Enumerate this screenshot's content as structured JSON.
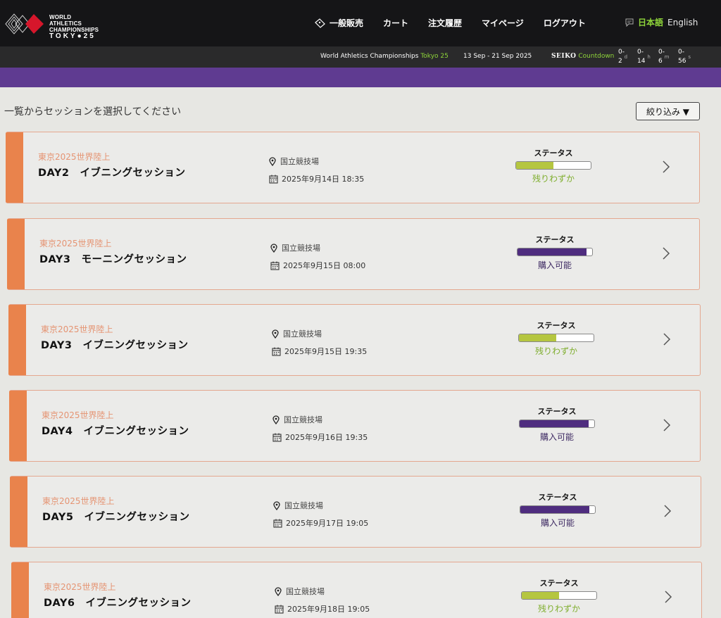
{
  "header": {
    "logo_lines": [
      "WORLD ATHLETICS",
      "CHAMPIONSHIPS",
      "TOKY●25"
    ],
    "nav": [
      {
        "label": "一般販売",
        "icon": "ticket-icon"
      },
      {
        "label": "カート"
      },
      {
        "label": "注文履歴"
      },
      {
        "label": "マイページ"
      },
      {
        "label": "ログアウト"
      }
    ],
    "lang_jp": "日本語",
    "lang_en": "English"
  },
  "subbar": {
    "event_prefix": "World Athletics Championships",
    "event_suffix": "Tokyo 25",
    "dates": "13 Sep - 21 Sep 2025",
    "seiko": "SEIKO",
    "countdown_label": "Countdown",
    "countdown": [
      {
        "value": "2",
        "unit": "d"
      },
      {
        "value": "14",
        "unit": "h"
      },
      {
        "value": "6",
        "unit": "m"
      },
      {
        "value": "56",
        "unit": "s"
      }
    ],
    "countdown_prefix": "0-"
  },
  "main": {
    "title": "一覧からセッションを選択してください",
    "filter_label": "絞り込み ▼",
    "status_label": "ステータス",
    "sessions": [
      {
        "event": "東京2025世界陸上",
        "name": "DAY2　イブニングセッション",
        "venue": "国立競技場",
        "datetime": "2025年9月14日 18:35",
        "status": "残りわずか",
        "level": 0.5
      },
      {
        "event": "東京2025世界陸上",
        "name": "DAY3　モーニングセッション",
        "venue": "国立競技場",
        "datetime": "2025年9月15日 08:00",
        "status": "購入可能",
        "level": 0.92
      },
      {
        "event": "東京2025世界陸上",
        "name": "DAY3　イブニングセッション",
        "venue": "国立競技場",
        "datetime": "2025年9月15日 19:35",
        "status": "残りわずか",
        "level": 0.5
      },
      {
        "event": "東京2025世界陸上",
        "name": "DAY4　イブニングセッション",
        "venue": "国立競技場",
        "datetime": "2025年9月16日 19:35",
        "status": "購入可能",
        "level": 0.92
      },
      {
        "event": "東京2025世界陸上",
        "name": "DAY5　イブニングセッション",
        "venue": "国立競技場",
        "datetime": "2025年9月17日 19:05",
        "status": "購入可能",
        "level": 0.92
      },
      {
        "event": "東京2025世界陸上",
        "name": "DAY6　イブニングセッション",
        "venue": "国立競技場",
        "datetime": "2025年9月18日 19:05",
        "status": "残りわずか",
        "level": 0.5
      }
    ]
  },
  "colors": {
    "few_left": "#b5c640",
    "few_left_text": "#7fae2e",
    "available": "#4f2d7f",
    "available_text": "#3e2a63",
    "accent": "#e9834c",
    "purple_band": "#5f3b91"
  }
}
